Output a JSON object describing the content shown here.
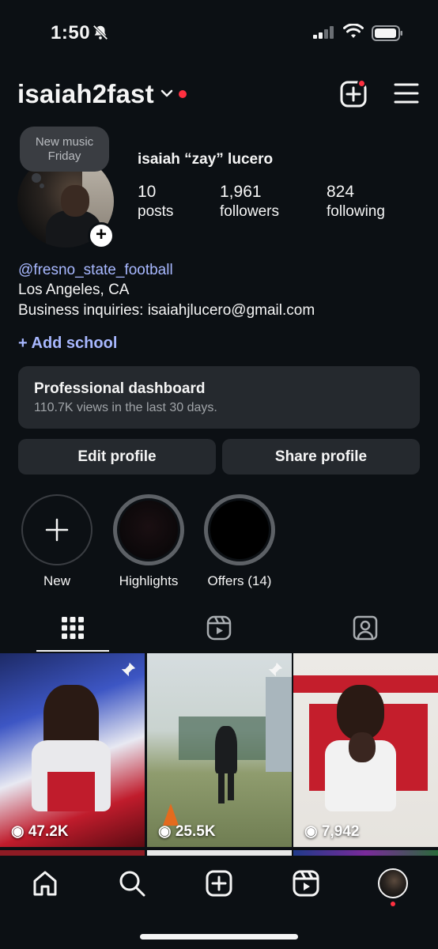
{
  "status": {
    "time": "1:50"
  },
  "header": {
    "username": "isaiah2fast"
  },
  "profile": {
    "note": "New music Friday",
    "display_name": "isaiah “zay” lucero",
    "stats": [
      {
        "value": "10",
        "label": "posts"
      },
      {
        "value": "1,961",
        "label": "followers"
      },
      {
        "value": "824",
        "label": "following"
      }
    ],
    "bio": {
      "link": "@fresno_state_football",
      "location": "Los Angeles, CA",
      "email_line": "Business inquiries: isaiahjlucero@gmail.com",
      "add_school": "+ Add school"
    },
    "dashboard": {
      "title": "Professional dashboard",
      "subtitle": "110.7K views in the last 30 days."
    },
    "buttons": {
      "edit": "Edit profile",
      "share": "Share profile"
    }
  },
  "highlights": [
    {
      "label": "New"
    },
    {
      "label": "Highlights"
    },
    {
      "label": "Offers (14)"
    }
  ],
  "posts": [
    {
      "views": "47.2K",
      "pinned": true
    },
    {
      "views": "25.5K",
      "pinned": true
    },
    {
      "views": "7,942",
      "pinned": false
    }
  ],
  "colors": {
    "background": "#0c1014",
    "accent_link": "#a8b8ff",
    "notification": "#ff3040",
    "card": "#25292e"
  }
}
